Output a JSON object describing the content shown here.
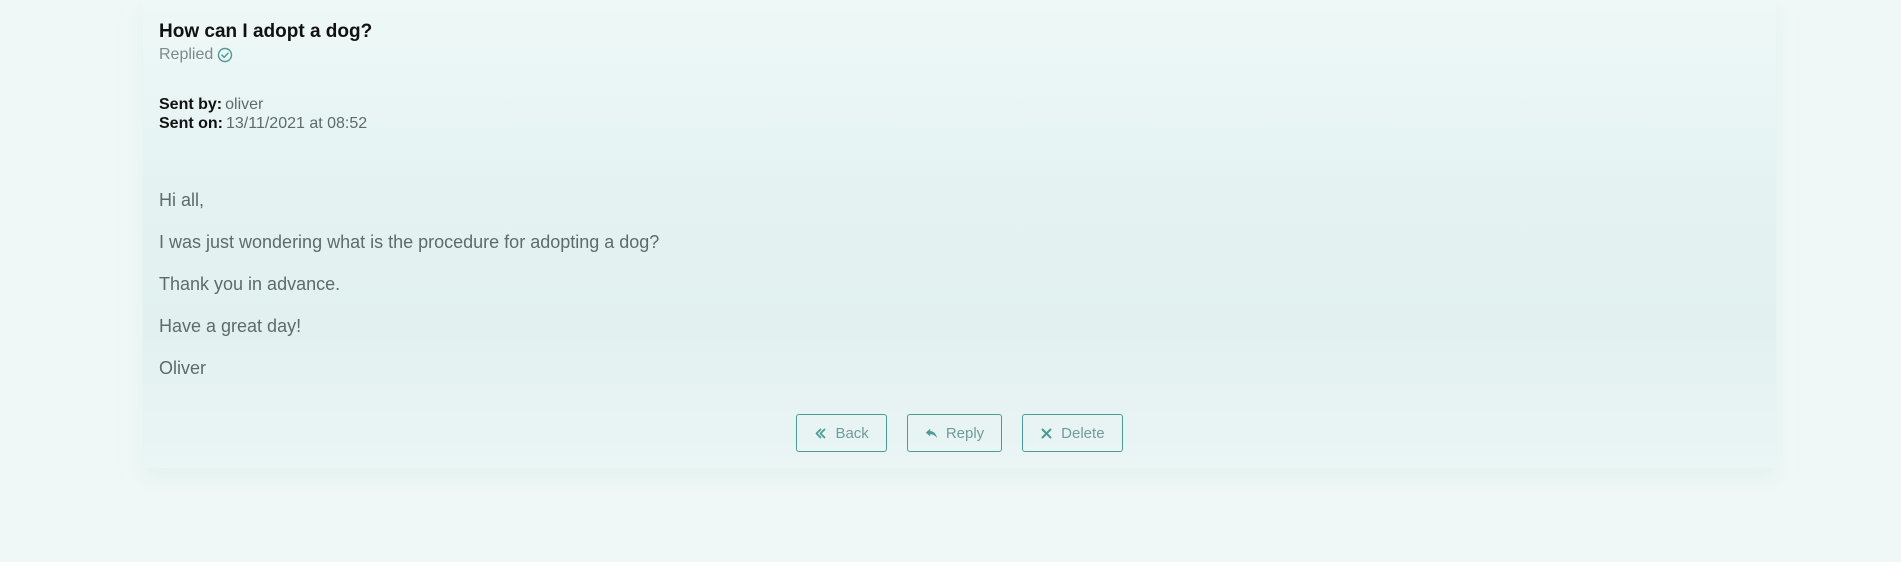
{
  "message": {
    "title": "How can I adopt a dog?",
    "status": "Replied",
    "sent_by_label": "Sent by:",
    "sent_by_value": "oliver",
    "sent_on_label": "Sent on:",
    "sent_on_value": "13/11/2021 at 08:52",
    "paragraphs": [
      "Hi all,",
      "I was just wondering what is the procedure for adopting a dog?",
      "Thank you in advance.",
      "Have a great day!",
      "Oliver"
    ]
  },
  "actions": {
    "back_label": "Back",
    "reply_label": "Reply",
    "delete_label": "Delete"
  },
  "colors": {
    "background": "#f0f8f7",
    "accent": "#4e9a99",
    "button_text": "#6e9c9b",
    "title": "#111111",
    "body_text": "#5d6b6a"
  },
  "icons": {
    "status": "check-circle-icon",
    "back": "double-chevron-left-icon",
    "reply": "reply-arrow-icon",
    "delete": "x-icon"
  }
}
